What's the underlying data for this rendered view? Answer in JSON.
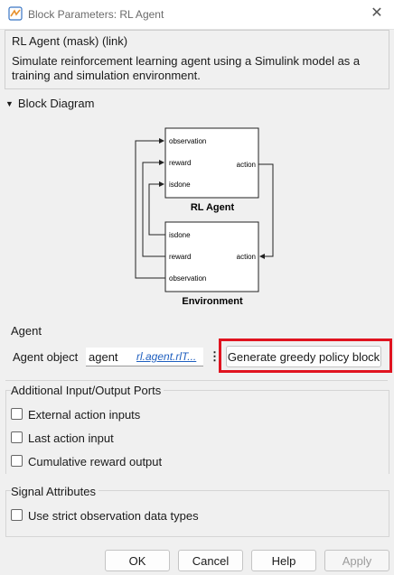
{
  "window": {
    "title": "Block Parameters: RL Agent"
  },
  "mask": {
    "title": "RL Agent (mask) (link)",
    "description": "Simulate reinforcement learning agent using a Simulink model as a training and simulation environment."
  },
  "block_diagram": {
    "header": "Block Diagram",
    "rl_agent": {
      "name": "RL Agent",
      "inputs": [
        "observation",
        "reward",
        "isdone"
      ],
      "output": "action"
    },
    "environment": {
      "name": "Environment",
      "outputs": [
        "isdone",
        "reward",
        "observation"
      ],
      "input": "action"
    }
  },
  "agent_group": {
    "title": "Agent",
    "object_label": "Agent object",
    "object_value": "agent",
    "type_link": "rl.agent.rlT...",
    "greedy_button": "Generate greedy policy block"
  },
  "ports_group": {
    "title": "Additional Input/Output Ports",
    "options": [
      {
        "label": "External action inputs",
        "checked": false
      },
      {
        "label": "Last action input",
        "checked": false
      },
      {
        "label": "Cumulative reward output",
        "checked": false
      }
    ]
  },
  "signal_group": {
    "title": "Signal Attributes",
    "options": [
      {
        "label": "Use strict observation data types",
        "checked": false
      }
    ]
  },
  "footer": {
    "ok": "OK",
    "cancel": "Cancel",
    "help": "Help",
    "apply": "Apply"
  },
  "colors": {
    "highlight": "#e0131f",
    "link": "#1f5fbf"
  }
}
